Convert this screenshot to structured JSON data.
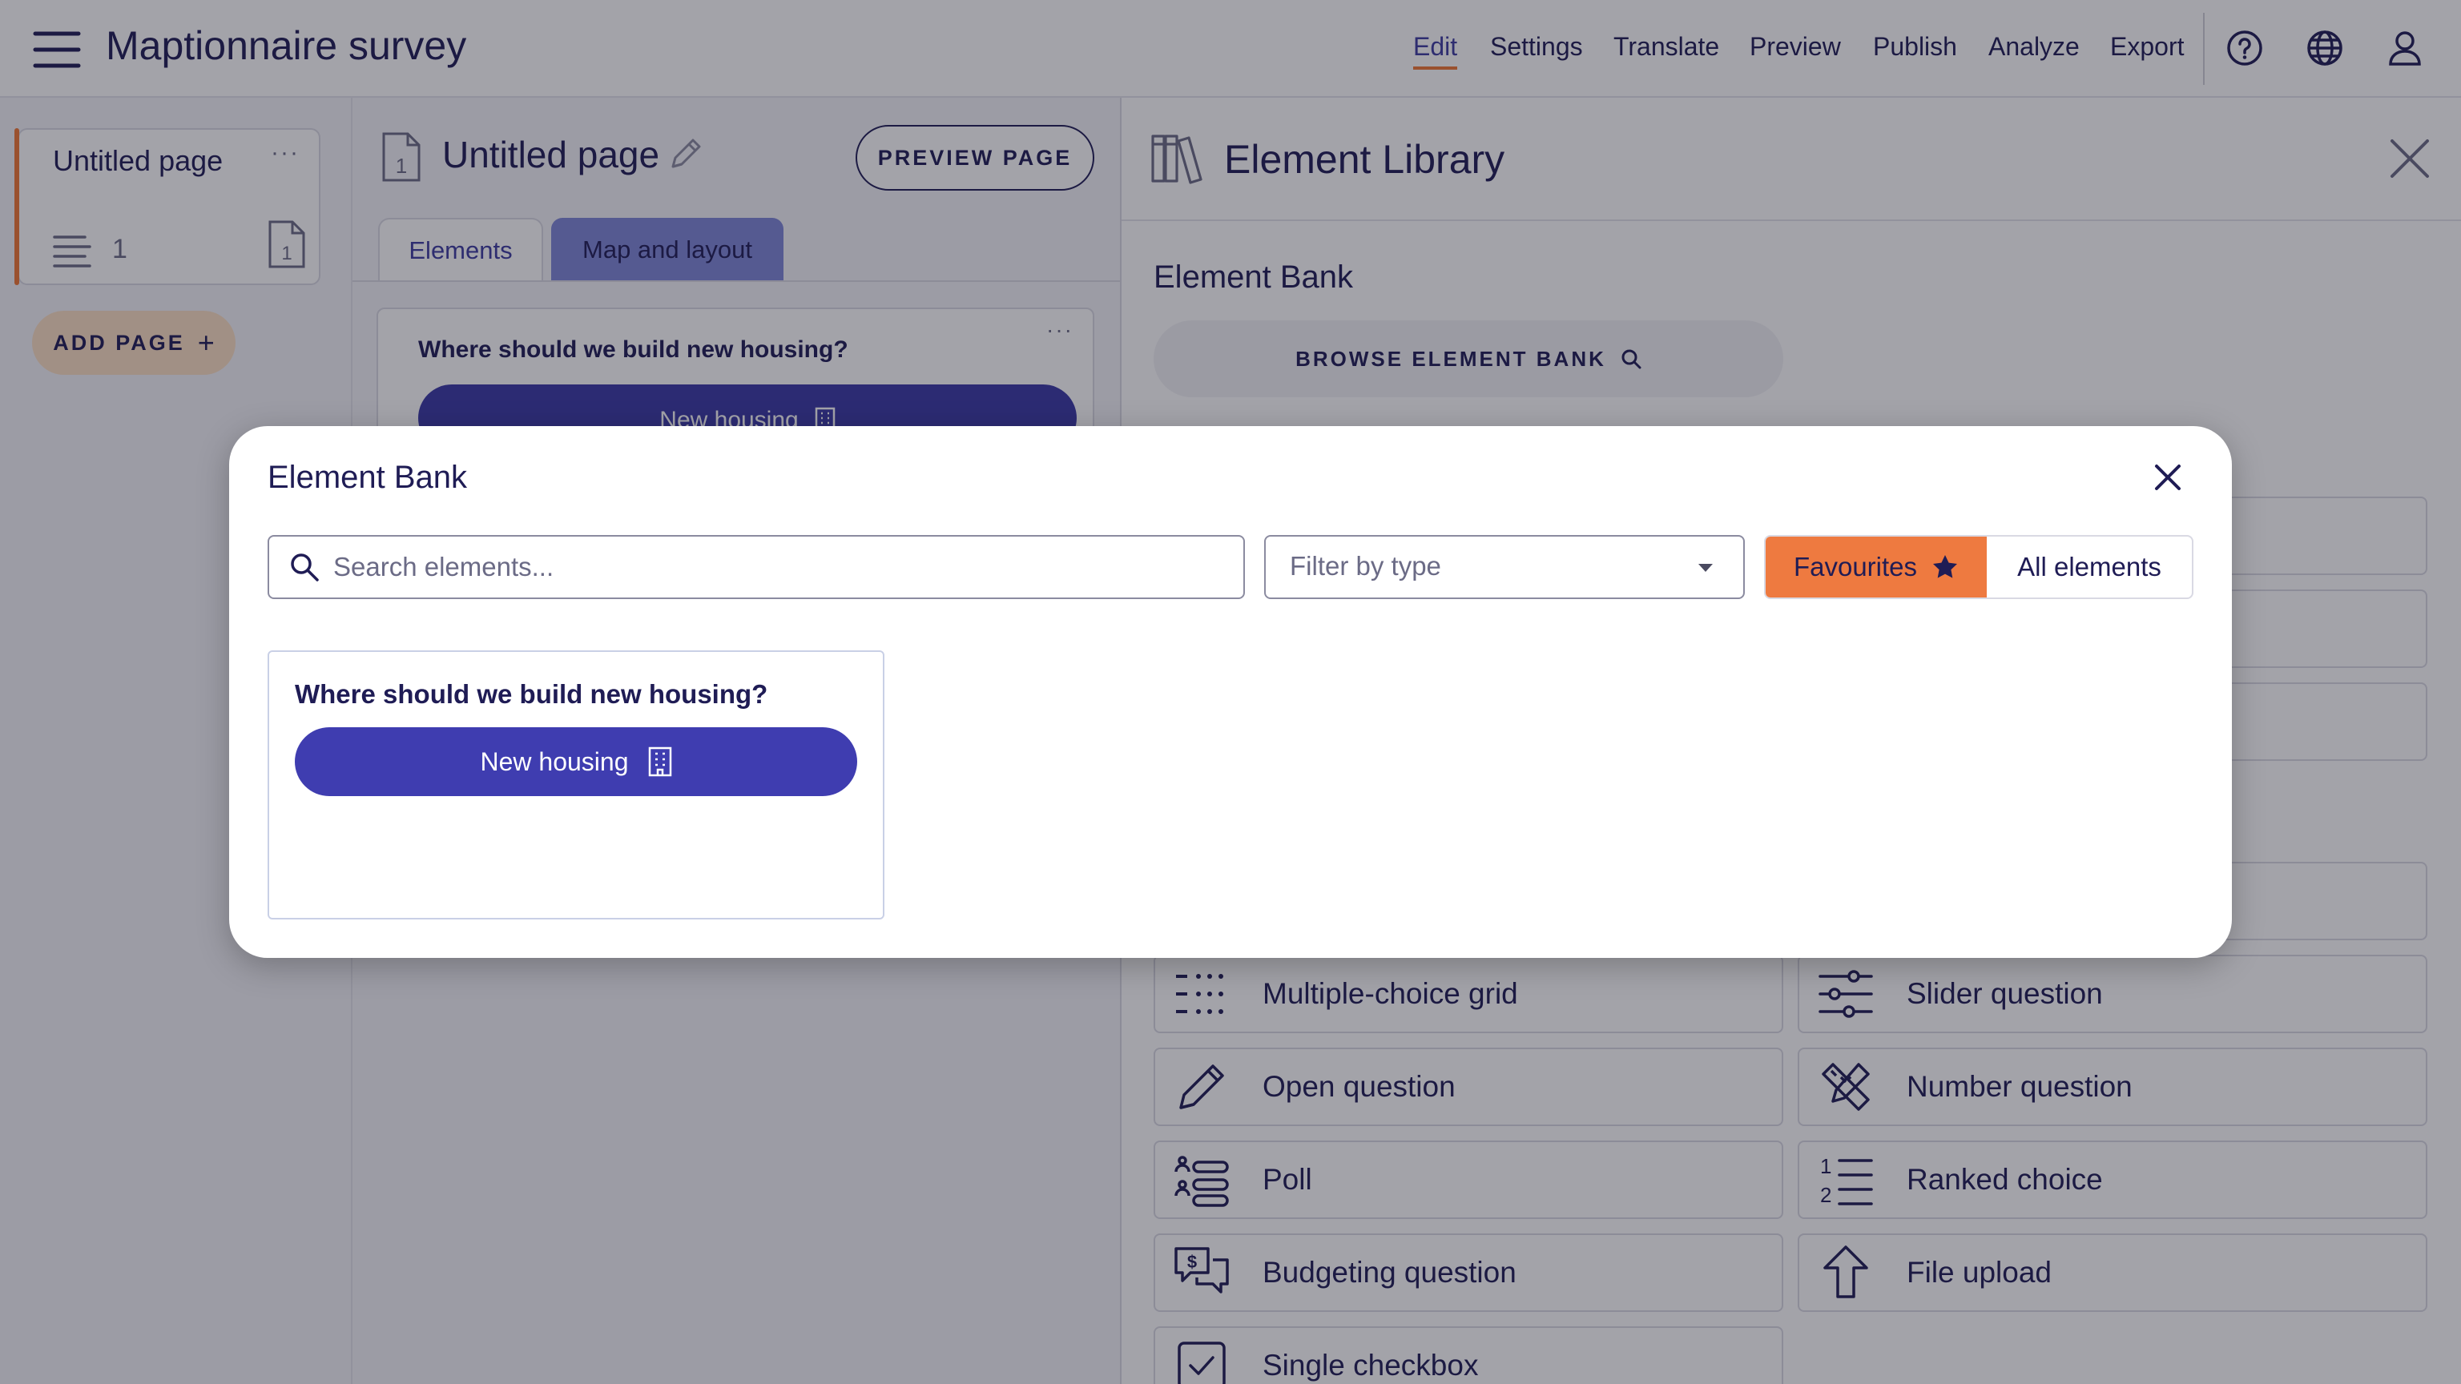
{
  "header": {
    "app_title": "Maptionnaire survey",
    "nav": [
      "Edit",
      "Settings",
      "Translate",
      "Preview",
      "Publish",
      "Analyze",
      "Export"
    ],
    "active_nav": "Edit",
    "icons": [
      "help-icon",
      "globe-icon",
      "user-icon"
    ]
  },
  "sidebar": {
    "page_card": {
      "title": "Untitled page",
      "more": "···",
      "count": "1",
      "page_number": "1"
    },
    "add_page_label": "ADD PAGE",
    "add_icon": "+"
  },
  "editor": {
    "page_title": "Untitled page",
    "page_number": "1",
    "preview_label": "PREVIEW PAGE",
    "tabs": [
      {
        "label": "Elements",
        "active": false
      },
      {
        "label": "Map and layout",
        "active": true
      }
    ],
    "element_card": {
      "question": "Where should we build new housing?",
      "button_label": "New housing",
      "more": "···"
    }
  },
  "library": {
    "title": "Element Library",
    "bank_heading": "Element Bank",
    "browse_label": "BROWSE ELEMENT BANK",
    "items": [
      {
        "label": "Multiple-choice grid",
        "icon": "grid-dots-icon"
      },
      {
        "label": "Slider question",
        "icon": "sliders-icon"
      },
      {
        "label": "Open question",
        "icon": "pencil-icon"
      },
      {
        "label": "Number question",
        "icon": "ruler-pencil-icon"
      },
      {
        "label": "Poll",
        "icon": "poll-icon"
      },
      {
        "label": "Ranked choice",
        "icon": "ranked-list-icon"
      },
      {
        "label": "Budgeting question",
        "icon": "budget-chat-icon"
      },
      {
        "label": "File upload",
        "icon": "upload-arrow-icon"
      },
      {
        "label": "Single checkbox",
        "icon": "checkbox-icon"
      }
    ]
  },
  "modal": {
    "title": "Element Bank",
    "search_placeholder": "Search elements...",
    "filter_placeholder": "Filter by type",
    "toggle_favourites": "Favourites",
    "toggle_all": "All elements",
    "active_toggle": "Favourites",
    "results": [
      {
        "title": "Where should we build new housing?",
        "button_label": "New housing"
      }
    ]
  },
  "colors": {
    "brand_navy": "#1f1c55",
    "primary_button": "#3f3db0",
    "accent_orange": "#ee7a40",
    "add_page_peach": "#fce0c4",
    "active_tab": "#7e86d8"
  }
}
